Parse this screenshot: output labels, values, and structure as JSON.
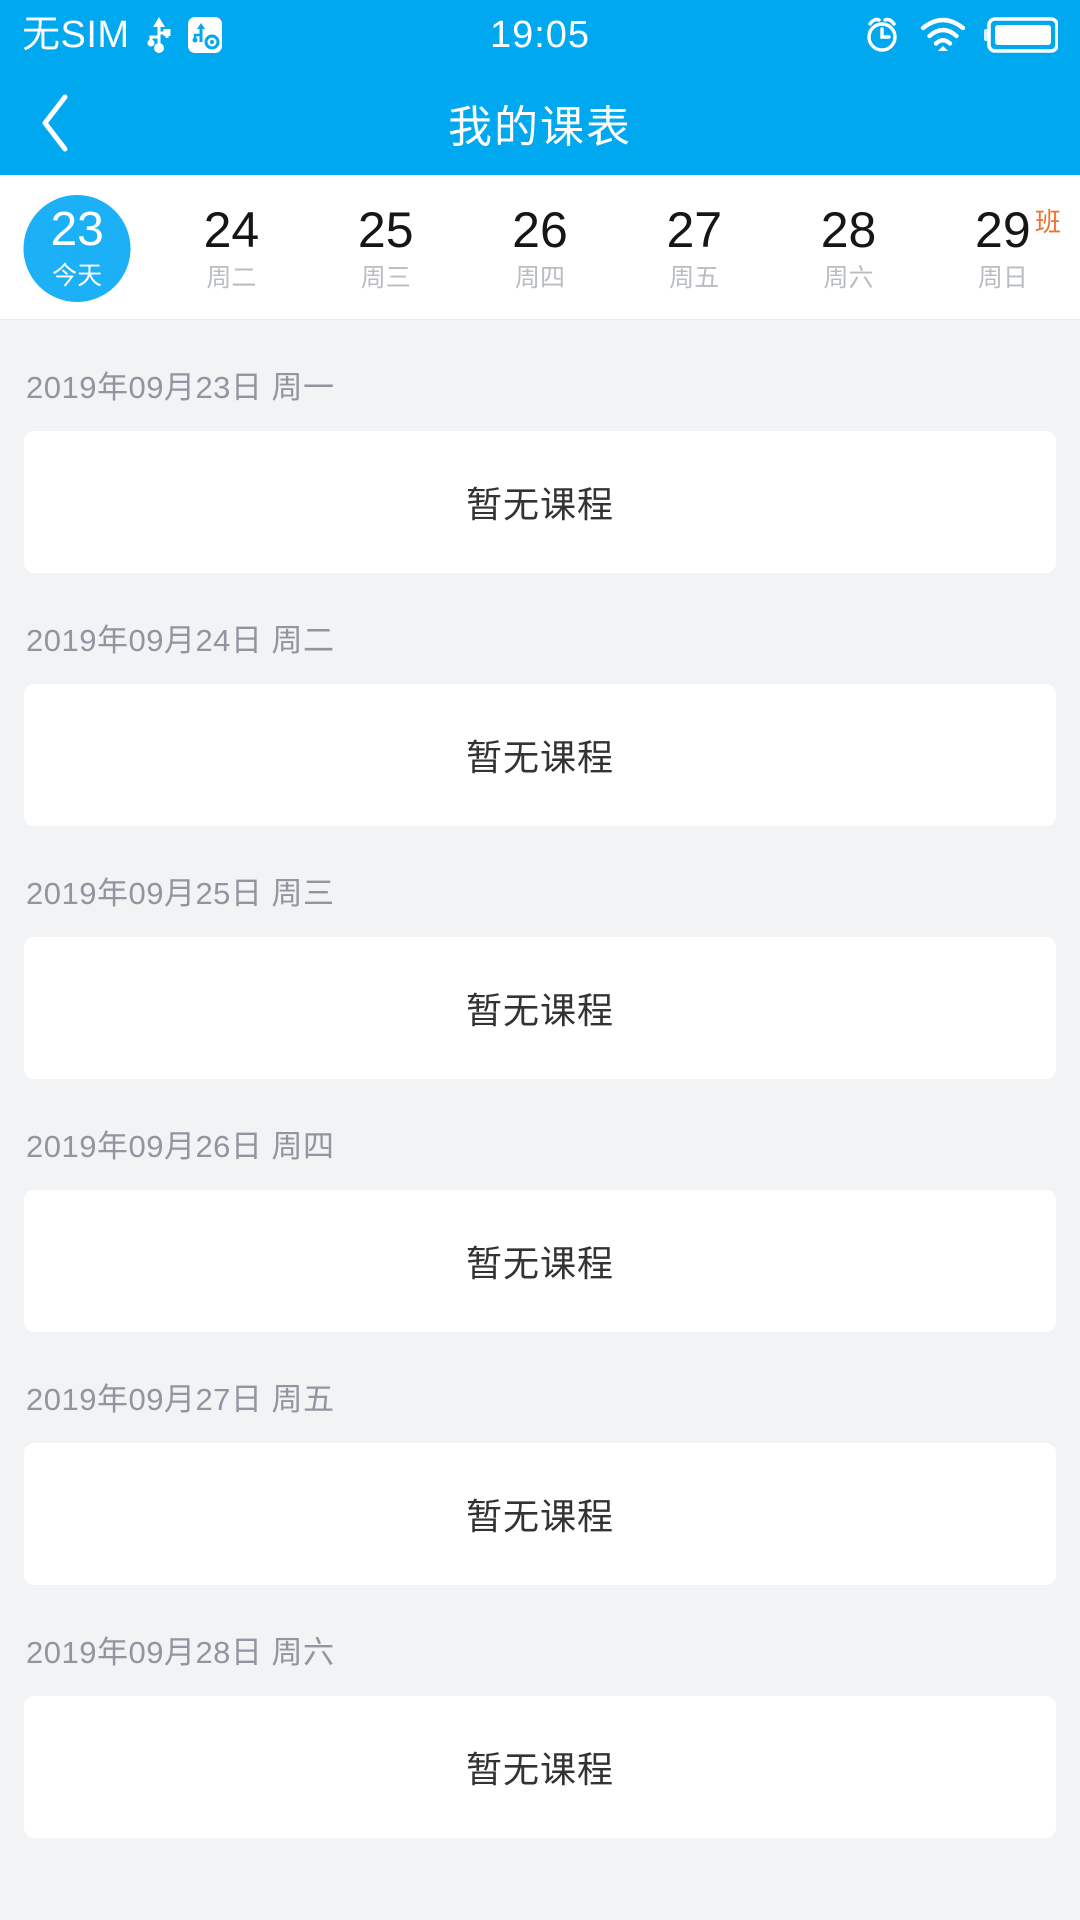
{
  "theme": {
    "accent": "#00a8f0",
    "today_bubble": "#1cb0f6",
    "badge_orange": "#f0712c",
    "page_bg": "#f2f3f5",
    "card_bg": "#ffffff",
    "muted_text": "#9096a0"
  },
  "status_bar": {
    "carrier": "无SIM",
    "time": "19:05",
    "icons": {
      "usb": "usb-icon",
      "usb_debug": "usb-debug-icon",
      "alarm": "alarm-icon",
      "wifi": "wifi-icon",
      "battery": "battery-icon"
    }
  },
  "nav": {
    "back_icon": "chevron-left-icon",
    "title": "我的课表"
  },
  "week_strip": {
    "days": [
      {
        "num": "23",
        "weekday": "今天",
        "today": true,
        "badge": ""
      },
      {
        "num": "24",
        "weekday": "周二",
        "today": false,
        "badge": ""
      },
      {
        "num": "25",
        "weekday": "周三",
        "today": false,
        "badge": ""
      },
      {
        "num": "26",
        "weekday": "周四",
        "today": false,
        "badge": ""
      },
      {
        "num": "27",
        "weekday": "周五",
        "today": false,
        "badge": ""
      },
      {
        "num": "28",
        "weekday": "周六",
        "today": false,
        "badge": ""
      },
      {
        "num": "29",
        "weekday": "周日",
        "today": false,
        "badge": "班"
      }
    ]
  },
  "schedule": {
    "empty_label": "暂无课程",
    "groups": [
      {
        "date": "2019年09月23日 周一",
        "empty": "暂无课程"
      },
      {
        "date": "2019年09月24日 周二",
        "empty": "暂无课程"
      },
      {
        "date": "2019年09月25日 周三",
        "empty": "暂无课程"
      },
      {
        "date": "2019年09月26日 周四",
        "empty": "暂无课程"
      },
      {
        "date": "2019年09月27日 周五",
        "empty": "暂无课程"
      },
      {
        "date": "2019年09月28日 周六",
        "empty": "暂无课程"
      }
    ]
  }
}
